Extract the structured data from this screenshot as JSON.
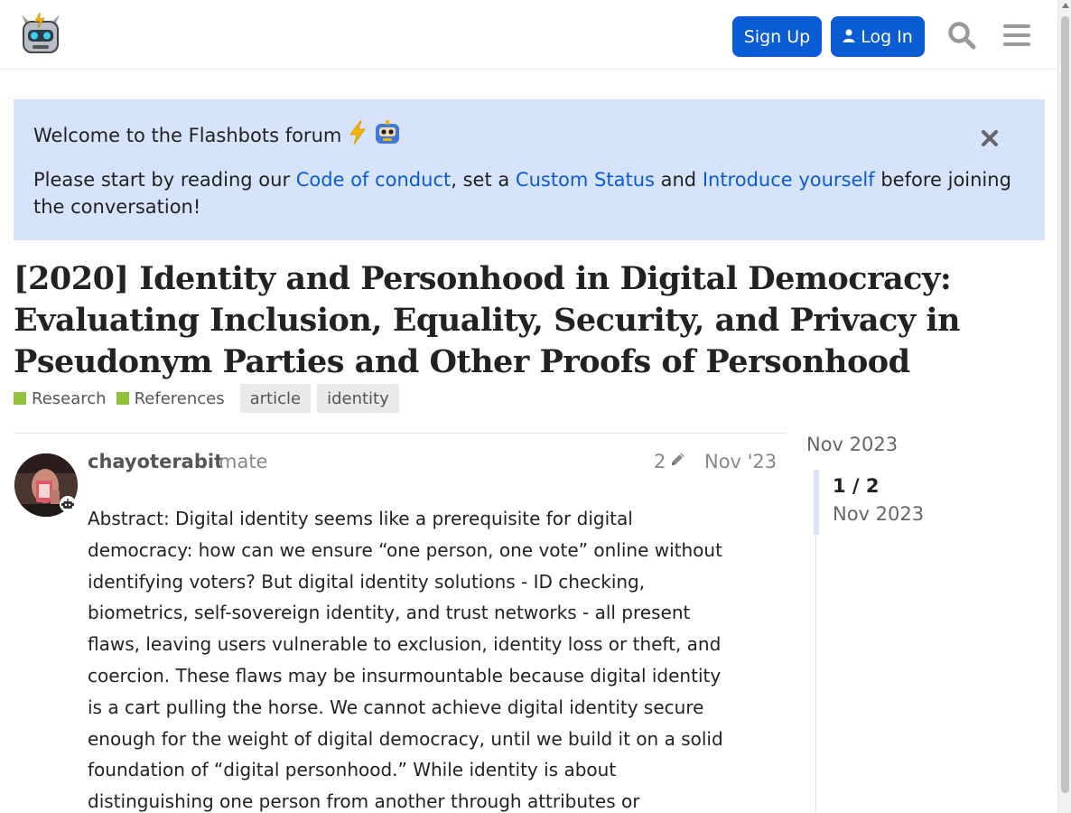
{
  "header": {
    "signup_label": "Sign Up",
    "login_label": "Log In",
    "icons": {
      "logo": "flashbots-robot-logo",
      "login": "user-icon",
      "search": "search-icon",
      "menu": "hamburger-menu-icon"
    }
  },
  "banner": {
    "title": "Welcome to the Flashbots forum",
    "text_before": "Please start by reading our ",
    "link_conduct": "Code of conduct",
    "text_mid1": ", set a ",
    "link_status": "Custom Status",
    "text_mid2": " and ",
    "link_introduce": "Introduce yourself",
    "text_after": " before joining the conversation!",
    "icons": {
      "emoji1": "lightning-emoji",
      "emoji2": "robot-emoji",
      "close": "close-icon"
    }
  },
  "topic": {
    "title_lines": [
      "[2020] Identity and Personhood in Digital Democracy:",
      "Evaluating Inclusion, Equality, Security, and Privacy in",
      "Pseudonym Parties and Other Proofs of Personhood"
    ],
    "categories": [
      {
        "name": "Research",
        "color": "#92c13d"
      },
      {
        "name": "References",
        "color": "#92c13d"
      }
    ],
    "tags": [
      "article",
      "identity"
    ]
  },
  "post": {
    "username": "chayoterabit",
    "user_title": "mate",
    "edit_count": "2",
    "date": "Nov '23",
    "body": "Abstract: Digital identity seems like a prerequisite for digital democracy: how can we ensure “one person, one vote” online without identifying voters? But digital identity solutions - ID checking, biometrics, self-sovereign identity, and trust networks - all present flaws, leaving users vulnerable to exclusion, identity loss or theft, and coercion. These flaws may be insurmountable because digital identity is a cart pulling the horse. We cannot achieve digital identity secure enough for the weight of digital democracy, until we build it on a solid foundation of “digital personhood.” While identity is about distinguishing one person from another through attributes or",
    "icons": {
      "edit": "pencil-icon",
      "badge": "robot-badge-icon"
    }
  },
  "timeline": {
    "start_date": "Nov 2023",
    "position": "1 / 2",
    "current_date": "Nov 2023"
  },
  "colors": {
    "accent": "#0a5cd5",
    "banner_bg": "#d6e3fb",
    "category": "#92c13d"
  }
}
